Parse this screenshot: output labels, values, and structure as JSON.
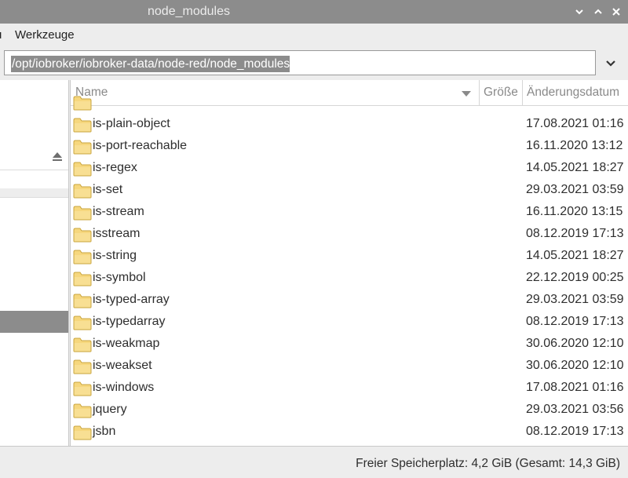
{
  "window": {
    "title": "node_modules",
    "controls": [
      "chevron-down-icon",
      "chevron-up-icon",
      "close-icon"
    ]
  },
  "menubar": {
    "items": [
      "u",
      "Werkzeuge"
    ]
  },
  "path": {
    "value": "/opt/iobroker/iobroker-data/node-red/node_modules"
  },
  "columns": {
    "name": "Name",
    "size": "Größe",
    "modified": "Änderungsdatum"
  },
  "files": [
    {
      "name": "is-plain-object",
      "date": "17.08.2021 01:16"
    },
    {
      "name": "is-port-reachable",
      "date": "16.11.2020 13:12"
    },
    {
      "name": "is-regex",
      "date": "14.05.2021 18:27"
    },
    {
      "name": "is-set",
      "date": "29.03.2021 03:59"
    },
    {
      "name": "is-stream",
      "date": "16.11.2020 13:15"
    },
    {
      "name": "isstream",
      "date": "08.12.2019 17:13"
    },
    {
      "name": "is-string",
      "date": "14.05.2021 18:27"
    },
    {
      "name": "is-symbol",
      "date": "22.12.2019 00:25"
    },
    {
      "name": "is-typed-array",
      "date": "29.03.2021 03:59"
    },
    {
      "name": "is-typedarray",
      "date": "08.12.2019 17:13"
    },
    {
      "name": "is-weakmap",
      "date": "30.06.2020 12:10"
    },
    {
      "name": "is-weakset",
      "date": "30.06.2020 12:10"
    },
    {
      "name": "is-windows",
      "date": "17.08.2021 01:16"
    },
    {
      "name": "jquery",
      "date": "29.03.2021 03:56"
    },
    {
      "name": "jsbn",
      "date": "08.12.2019 17:13"
    }
  ],
  "status": {
    "text": "Freier Speicherplatz: 4,2 GiB (Gesamt: 14,3 GiB)"
  },
  "colors": {
    "titlebar": "#8c8c8c",
    "selection": "#8c8c8c",
    "folder": "#f6d77e"
  }
}
